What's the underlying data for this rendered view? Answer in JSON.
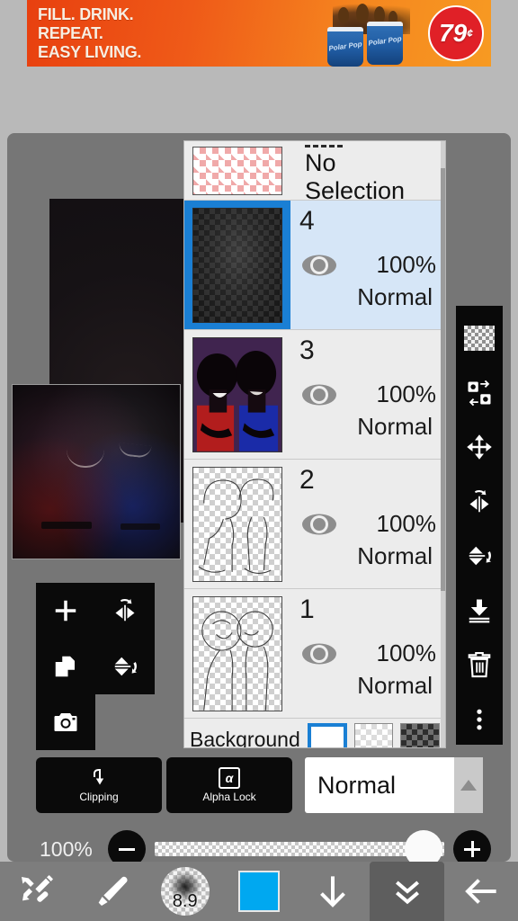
{
  "ad": {
    "line1": "FILL. DRINK.",
    "line2": "REPEAT.",
    "line3": "EASY LIVING.",
    "cup_label": "Polar Pop",
    "price": "79",
    "price_sup": "¢",
    "bg_color": "#ef5a18",
    "price_color": "#e02027"
  },
  "selection_row": {
    "title": "No Selection",
    "icon": "dashed-selection-icon"
  },
  "layers": [
    {
      "name": "4",
      "opacity": "100%",
      "blend": "Normal",
      "selected": true,
      "thumb": "dark-gradient"
    },
    {
      "name": "3",
      "opacity": "100%",
      "blend": "Normal",
      "selected": false,
      "thumb": "two-figures-color"
    },
    {
      "name": "2",
      "opacity": "100%",
      "blend": "Normal",
      "selected": false,
      "thumb": "lineart-bodies"
    },
    {
      "name": "1",
      "opacity": "100%",
      "blend": "Normal",
      "selected": false,
      "thumb": "lineart-heads"
    }
  ],
  "background_row": {
    "label": "Background",
    "swatches": [
      {
        "name": "white",
        "selected": true
      },
      {
        "name": "light-checker",
        "selected": false
      },
      {
        "name": "dark-checker",
        "selected": false
      }
    ]
  },
  "left_tools": [
    {
      "name": "add-layer",
      "icon": "plus-icon"
    },
    {
      "name": "flip-horizontal",
      "icon": "flip-horizontal-icon"
    },
    {
      "name": "duplicate-layer",
      "icon": "duplicate-icon"
    },
    {
      "name": "flip-vertical",
      "icon": "flip-vertical-icon"
    },
    {
      "name": "camera",
      "icon": "camera-icon"
    }
  ],
  "right_tools": [
    {
      "name": "transparency",
      "icon": "checkerboard-icon"
    },
    {
      "name": "swap-layers",
      "icon": "swap-layers-icon"
    },
    {
      "name": "move",
      "icon": "move-icon"
    },
    {
      "name": "flip-horizontal",
      "icon": "flip-horizontal-icon"
    },
    {
      "name": "flip-vertical",
      "icon": "flip-vertical-icon"
    },
    {
      "name": "merge-down",
      "icon": "merge-down-icon"
    },
    {
      "name": "delete-layer",
      "icon": "trash-icon"
    },
    {
      "name": "more-options",
      "icon": "more-vertical-icon"
    }
  ],
  "controls": {
    "clipping_label": "Clipping",
    "clipping_icon": "clipping-arrow-icon",
    "alpha_lock_label": "Alpha Lock",
    "alpha_lock_icon": "alpha-lock-icon",
    "blend_mode": "Normal",
    "blend_dropdown_icon": "triangle-up-icon",
    "opacity_label": "100%",
    "opacity_value": 100,
    "minus_icon": "minus-icon",
    "plus_icon": "plus-icon"
  },
  "bottom_nav": [
    {
      "name": "undo-redo",
      "icon": "undo-redo-icon",
      "active": false
    },
    {
      "name": "brush-tool",
      "icon": "brush-icon",
      "active": false
    },
    {
      "name": "brush-size",
      "icon": "brush-size-icon",
      "value": "8.9",
      "active": false
    },
    {
      "name": "color-swatch",
      "icon": "color-swatch-icon",
      "color": "#00a8f0",
      "active": false
    },
    {
      "name": "download",
      "icon": "arrow-down-icon",
      "active": false
    },
    {
      "name": "collapse-panel",
      "icon": "double-chevron-down-icon",
      "active": true
    },
    {
      "name": "back",
      "icon": "arrow-left-icon",
      "active": false
    }
  ]
}
